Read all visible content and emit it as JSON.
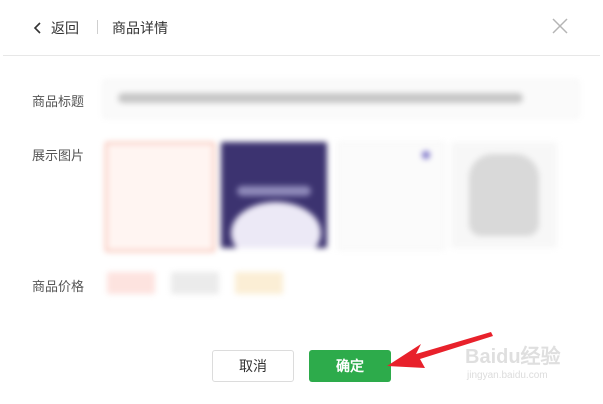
{
  "header": {
    "back_label": "返回",
    "title": "商品详情"
  },
  "form": {
    "title_label": "商品标题",
    "images_label": "展示图片",
    "price_label": "商品价格"
  },
  "actions": {
    "cancel_label": "取消",
    "confirm_label": "确定"
  },
  "watermark": {
    "line1": "Baidu经验",
    "line2": "jingyan.baidu.com"
  },
  "colors": {
    "primary_green": "#2dab4b",
    "annotation_arrow": "#e8212b"
  }
}
